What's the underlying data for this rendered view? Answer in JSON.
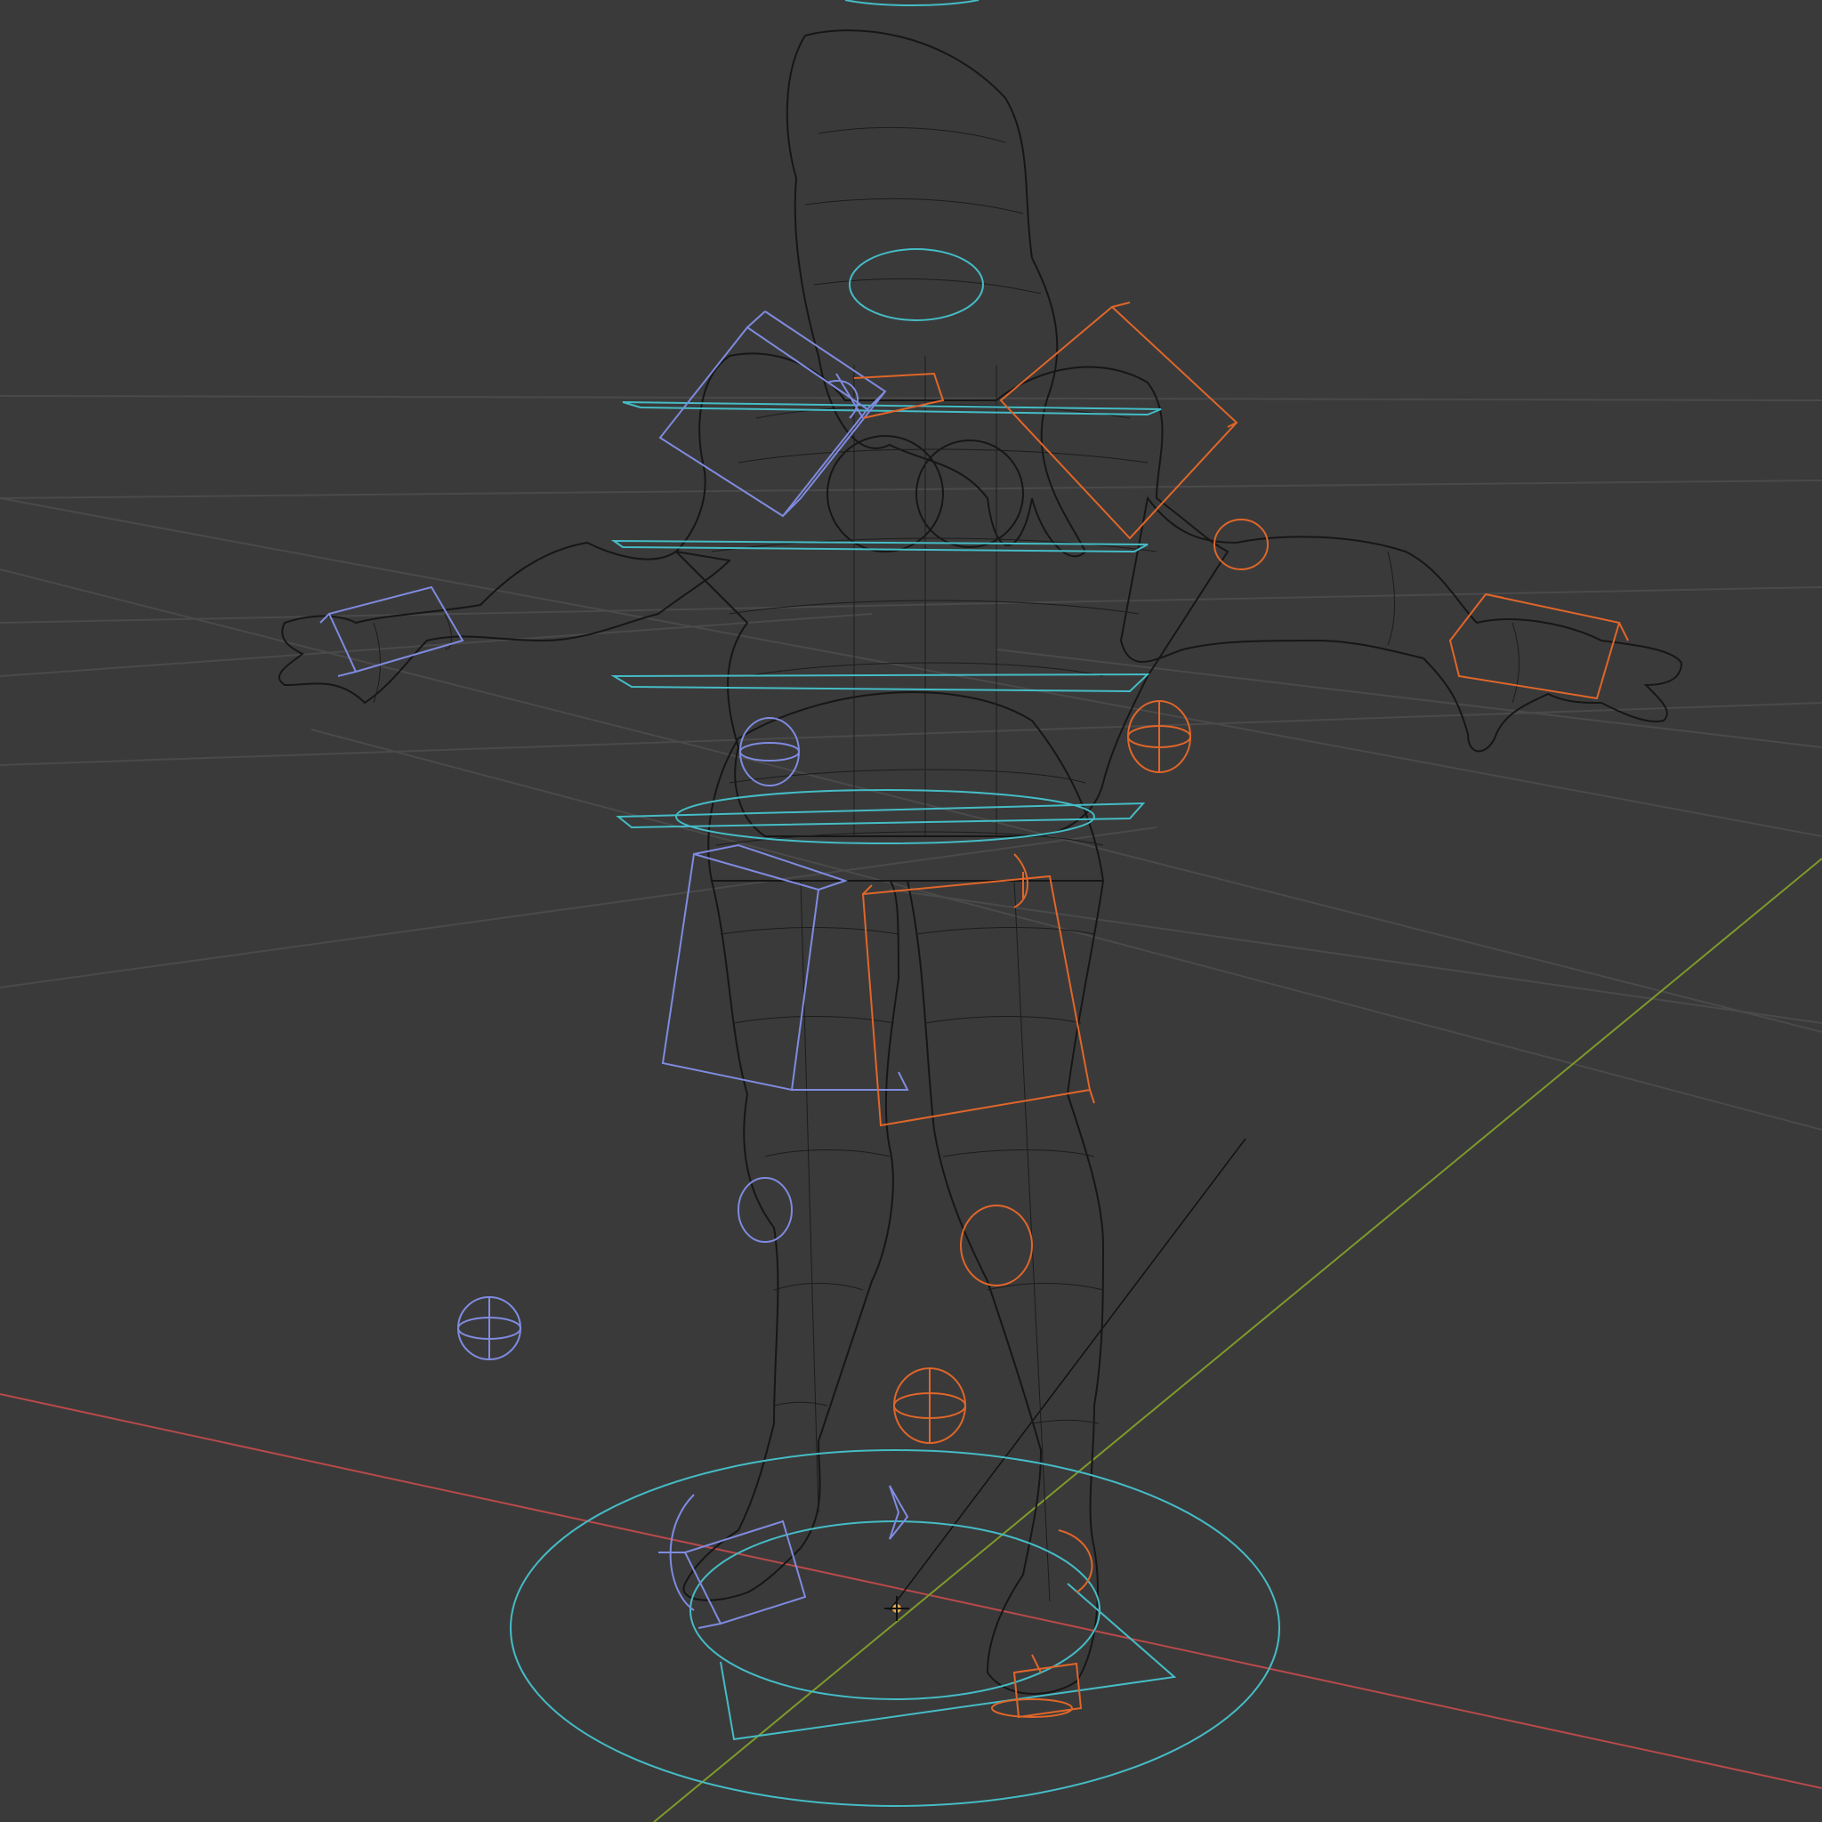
{
  "viewport": {
    "mode": "wireframe",
    "object": "rigged-character-t-pose",
    "colors": {
      "background": "#3a3a3a",
      "grid": "#4a4a4a",
      "axis_x": "#b9494a",
      "axis_y": "#7e9a2b",
      "mesh_wire": "#161616",
      "control_center": "#45bcc6",
      "control_right": "#7f8be0",
      "control_left": "#e0662a",
      "origin": "#e0a84a"
    },
    "icons": {
      "origin": "3d-cursor-icon"
    }
  }
}
